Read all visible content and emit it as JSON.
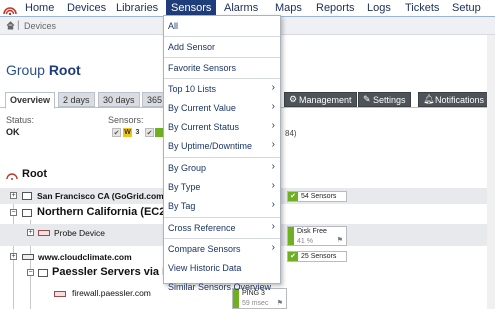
{
  "nav": {
    "items": [
      "Home",
      "Devices",
      "Libraries",
      "Sensors",
      "Alarms",
      "Maps",
      "Reports",
      "Logs",
      "Tickets",
      "Setup"
    ],
    "active": "Sensors"
  },
  "breadcrumb": {
    "item": "Devices"
  },
  "page": {
    "title_prefix": "Group",
    "title_name": "Root"
  },
  "tabs": [
    "Overview",
    "2 days",
    "30 days",
    "365",
    "Management",
    "Settings",
    "Notifications"
  ],
  "status": {
    "status_label": "Status:",
    "status_value": "OK",
    "sensors_label": "Sensors:",
    "badge_count": "3",
    "tail_text": "84)"
  },
  "tree": {
    "root": "Root",
    "groups": [
      {
        "name": "San Francisco CA (GoGrid.com)",
        "tile": "54 Sensors"
      },
      {
        "name": "Northern California (EC2 M",
        "tile": ""
      },
      {
        "name": "Probe Device",
        "tile": "Disk Free",
        "tile_value": "41 %"
      },
      {
        "name": "www.cloudclimate.com",
        "tile": "25 Sensors"
      },
      {
        "name": "Paessler Servers via Nor",
        "tile": ""
      },
      {
        "name": "firewall.paessler.com",
        "tile": "PING 3",
        "tile_value": "59 msec"
      }
    ]
  },
  "dropdown": {
    "items": [
      {
        "label": "All",
        "arrow": false
      },
      {
        "label": "Add Sensor",
        "arrow": false
      },
      {
        "label": "Favorite Sensors",
        "arrow": false
      },
      {
        "label": "Top 10 Lists",
        "arrow": true
      },
      {
        "label": "By Current Value",
        "arrow": true
      },
      {
        "label": "By Current Status",
        "arrow": true
      },
      {
        "label": "By Uptime/Downtime",
        "arrow": true
      },
      {
        "label": "By Group",
        "arrow": true
      },
      {
        "label": "By Type",
        "arrow": true
      },
      {
        "label": "By Tag",
        "arrow": true
      },
      {
        "label": "Cross Reference",
        "arrow": true
      },
      {
        "label": "Compare Sensors",
        "arrow": true
      },
      {
        "label": "View Historic Data",
        "arrow": false
      },
      {
        "label": "Similar Sensors Overview",
        "arrow": false
      }
    ],
    "arrow_glyph": "›"
  },
  "colors": {
    "nav_active": "#1f3d7a",
    "ok_green": "#6fb023",
    "warning_yellow": "#f0c419"
  },
  "icons": [
    "prtg-logo-icon",
    "home-icon",
    "gear-icon",
    "wrench-icon",
    "bell-icon",
    "check-icon",
    "flag-icon",
    "group-icon",
    "device-icon"
  ]
}
